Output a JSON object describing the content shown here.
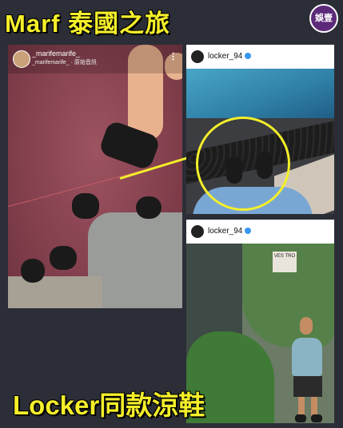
{
  "header": {
    "title": "Marf 泰國之旅",
    "logo_text": "娛壹"
  },
  "story": {
    "username": "_marifemarife_",
    "subline": "_marifemarife_ · 原始音訊",
    "more_icon": "more-dots-icon"
  },
  "post_top": {
    "username": "locker_94",
    "verified_icon": "verified-badge-icon"
  },
  "post_bottom": {
    "username": "locker_94",
    "verified_icon": "verified-badge-icon",
    "sign_text": "VES TRO"
  },
  "footer": {
    "caption": "Locker同款涼鞋"
  },
  "colors": {
    "accent_yellow": "#f4ef2a",
    "background": "#2b2e36",
    "story_floor": "#8c4752"
  }
}
